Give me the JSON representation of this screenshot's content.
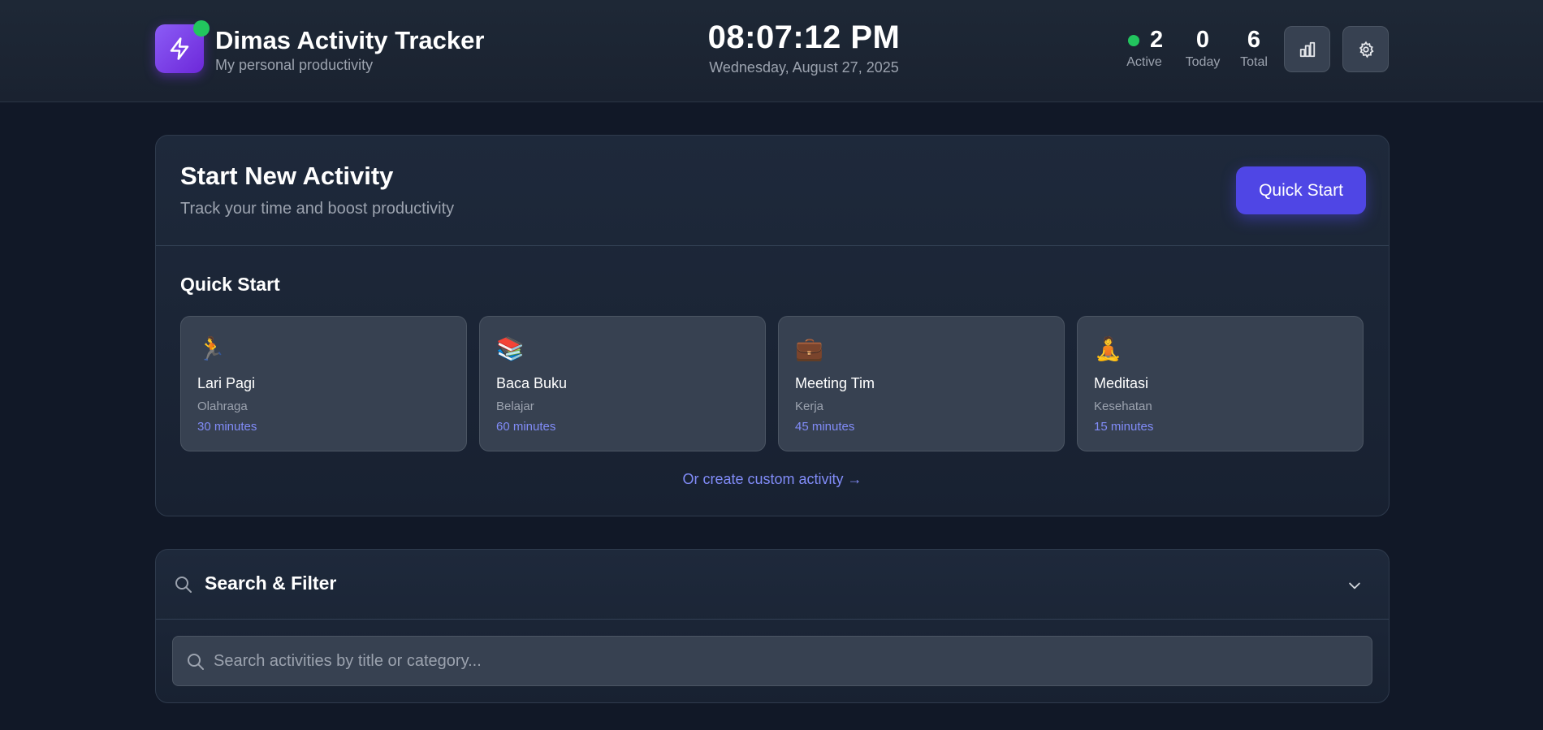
{
  "header": {
    "app_title": "Dimas Activity Tracker",
    "app_subtitle": "My personal productivity",
    "logo_icon": "lightning-bolt-icon",
    "time": "08:07:12 PM",
    "date": "Wednesday, August 27, 2025",
    "stats": {
      "active": {
        "value": "2",
        "label": "Active"
      },
      "today": {
        "value": "0",
        "label": "Today"
      },
      "total": {
        "value": "6",
        "label": "Total"
      }
    },
    "buttons": {
      "stats_icon": "bar-chart-icon",
      "settings_icon": "gear-icon"
    }
  },
  "start_activity": {
    "title": "Start New Activity",
    "subtitle": "Track your time and boost productivity",
    "quick_start_button": "Quick Start",
    "section_title": "Quick Start",
    "tiles": [
      {
        "emoji": "🏃",
        "name": "Lari Pagi",
        "category": "Olahraga",
        "duration": "30 minutes"
      },
      {
        "emoji": "📚",
        "name": "Baca Buku",
        "category": "Belajar",
        "duration": "60 minutes"
      },
      {
        "emoji": "💼",
        "name": "Meeting Tim",
        "category": "Kerja",
        "duration": "45 minutes"
      },
      {
        "emoji": "🧘",
        "name": "Meditasi",
        "category": "Kesehatan",
        "duration": "15 minutes"
      }
    ],
    "custom_link": "Or create custom activity →"
  },
  "search": {
    "title": "Search & Filter",
    "placeholder": "Search activities by title or category...",
    "value": ""
  },
  "colors": {
    "background": "#111827",
    "accent": "#4f46e5",
    "accent_text": "#818cf8",
    "status_green": "#22c55e"
  }
}
